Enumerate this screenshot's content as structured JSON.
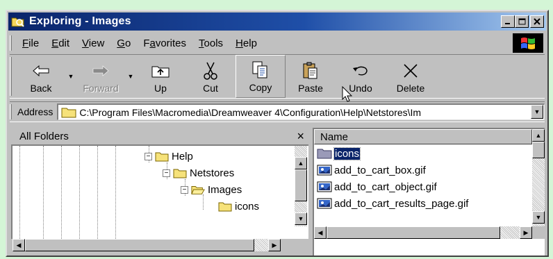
{
  "window": {
    "title": "Exploring - Images",
    "buttons": {
      "minimize": "_",
      "maximize": "□",
      "close": "✕"
    }
  },
  "menu": [
    {
      "label": "File",
      "hotkey": "F",
      "rest": "ile"
    },
    {
      "label": "Edit",
      "hotkey": "E",
      "rest": "dit"
    },
    {
      "label": "View",
      "hotkey": "V",
      "rest": "iew"
    },
    {
      "label": "Go",
      "hotkey": "G",
      "rest": "o"
    },
    {
      "label": "Favorites",
      "hotkey": "a",
      "pre": "F",
      "rest": "vorites"
    },
    {
      "label": "Tools",
      "hotkey": "T",
      "rest": "ools"
    },
    {
      "label": "Help",
      "hotkey": "H",
      "rest": "elp"
    }
  ],
  "toolbar": {
    "back": "Back",
    "forward": "Forward",
    "up": "Up",
    "cut": "Cut",
    "copy": "Copy",
    "paste": "Paste",
    "undo": "Undo",
    "delete": "Delete"
  },
  "address": {
    "label": "Address",
    "value": "C:\\Program Files\\Macromedia\\Dreamweaver 4\\Configuration\\Help\\Netstores\\Im"
  },
  "folders_pane": {
    "title": "All Folders",
    "close": "×",
    "tree": [
      {
        "label": "Help",
        "expander": "−"
      },
      {
        "label": "Netstores",
        "expander": "−"
      },
      {
        "label": "Images",
        "expander": "−"
      },
      {
        "label": "icons"
      }
    ]
  },
  "files_pane": {
    "column_name": "Name",
    "files": [
      {
        "name": "icons",
        "type": "folder",
        "selected": true
      },
      {
        "name": "add_to_cart_box.gif",
        "type": "image"
      },
      {
        "name": "add_to_cart_object.gif",
        "type": "image"
      },
      {
        "name": "add_to_cart_results_page.gif",
        "type": "image"
      }
    ]
  },
  "colors": {
    "titlebar_start": "#0a246a",
    "titlebar_end": "#a6caf0",
    "selection": "#0a246a",
    "chrome": "#c0c0c0",
    "desktop": "#d4f5d6"
  }
}
